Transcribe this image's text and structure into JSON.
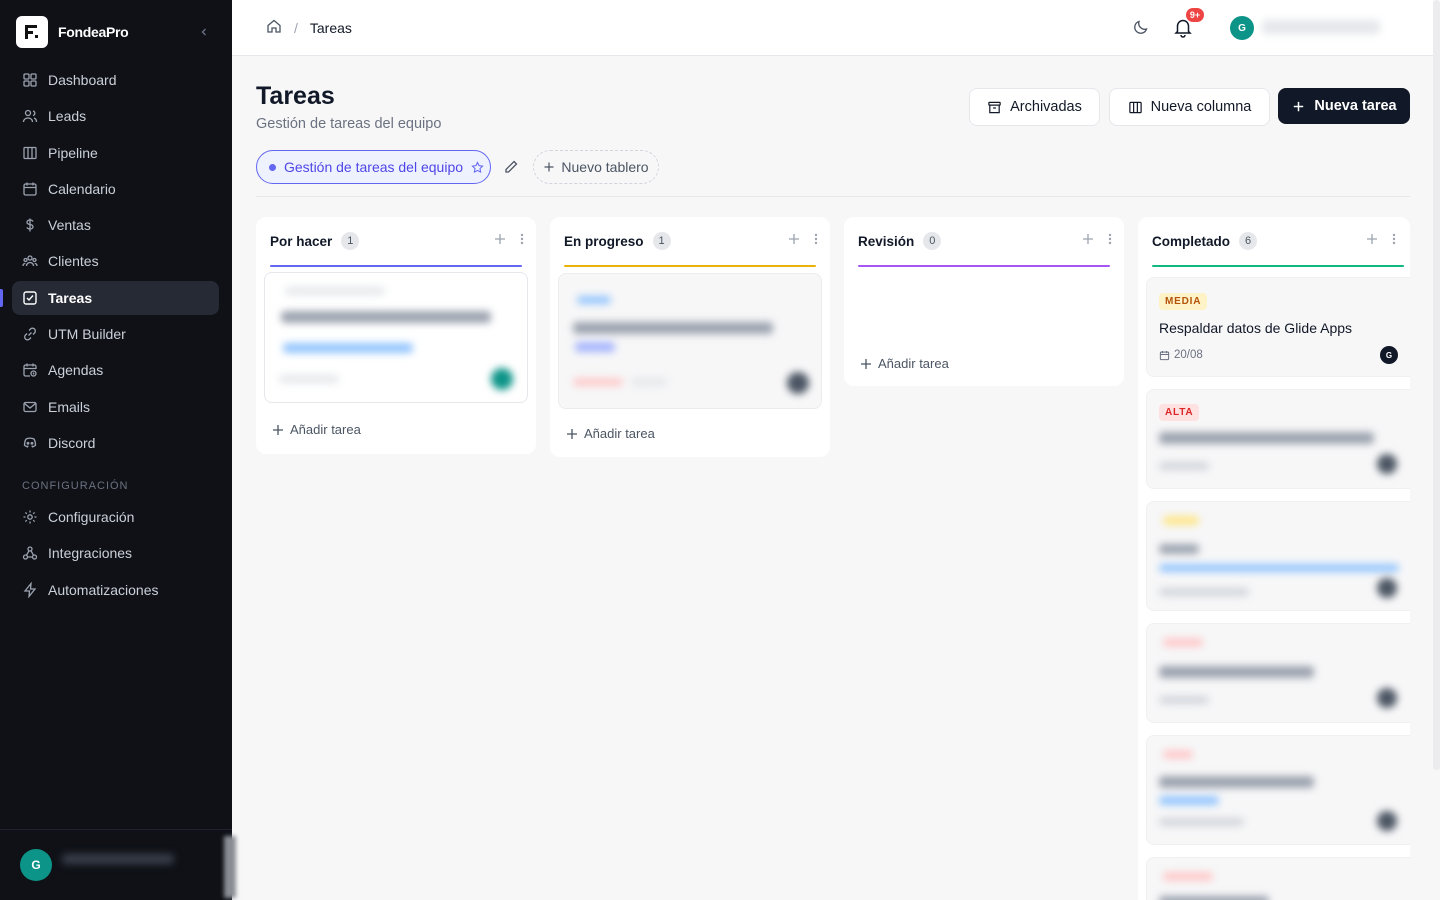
{
  "app": {
    "name": "FondeaPro"
  },
  "sidebar": {
    "items": [
      {
        "label": "Dashboard",
        "icon": "dashboard-icon"
      },
      {
        "label": "Leads",
        "icon": "users-icon"
      },
      {
        "label": "Pipeline",
        "icon": "kanban-icon"
      },
      {
        "label": "Calendario",
        "icon": "calendar-icon"
      },
      {
        "label": "Ventas",
        "icon": "dollar-icon"
      },
      {
        "label": "Clientes",
        "icon": "clients-icon"
      },
      {
        "label": "Tareas",
        "icon": "checkbox-icon",
        "active": true
      },
      {
        "label": "UTM Builder",
        "icon": "link-icon"
      },
      {
        "label": "Agendas",
        "icon": "calendar-clock-icon"
      },
      {
        "label": "Emails",
        "icon": "mail-icon"
      },
      {
        "label": "Discord",
        "icon": "discord-icon"
      }
    ],
    "section_label": "CONFIGURACIÓN",
    "config_items": [
      {
        "label": "Configuración",
        "icon": "gear-icon"
      },
      {
        "label": "Integraciones",
        "icon": "webhook-icon"
      },
      {
        "label": "Automatizaciones",
        "icon": "bolt-icon"
      }
    ],
    "footer": {
      "avatar_initial": "G"
    }
  },
  "topbar": {
    "breadcrumb": {
      "home_icon": "home-icon",
      "separator": "/",
      "current": "Tareas"
    },
    "notifications": {
      "badge": "9+"
    },
    "avatar_initial": "G"
  },
  "header": {
    "title": "Tareas",
    "subtitle": "Gestión de tareas del equipo",
    "buttons": {
      "archived": "Archivadas",
      "new_column": "Nueva columna",
      "new_task": "Nueva tarea"
    }
  },
  "boards": {
    "active": "Gestión de tareas del equipo",
    "new_board": "Nuevo tablero"
  },
  "columns": [
    {
      "title": "Por hacer",
      "count": "1",
      "color": "#6366f1",
      "add_label": "Añadir tarea"
    },
    {
      "title": "En progreso",
      "count": "1",
      "color": "#eab308",
      "add_label": "Añadir tarea"
    },
    {
      "title": "Revisión",
      "count": "0",
      "color": "#a855f7",
      "add_label": "Añadir tarea"
    },
    {
      "title": "Completado",
      "count": "6",
      "color": "#10b981"
    }
  ],
  "completed_tasks": [
    {
      "priority": "MEDIA",
      "title": "Respaldar datos de Glide Apps",
      "due": "20/08",
      "assignee": "G"
    },
    {
      "priority": "ALTA"
    }
  ]
}
